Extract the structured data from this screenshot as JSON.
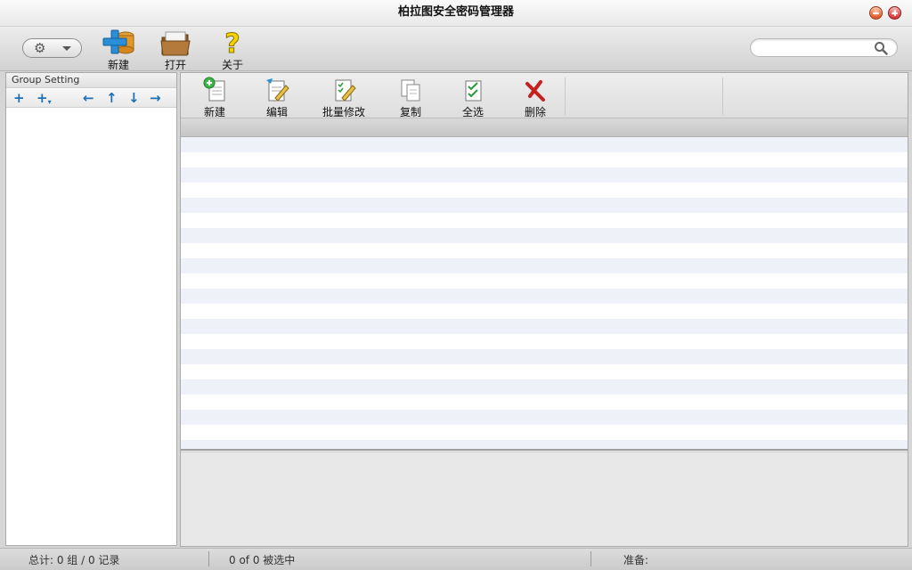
{
  "window": {
    "title": "柏拉图安全密码管理器"
  },
  "main_toolbar": {
    "new_label": "新建",
    "open_label": "打开",
    "about_label": "关于",
    "search_placeholder": ""
  },
  "group_panel": {
    "title": "Group Setting"
  },
  "entry_toolbar": {
    "new_label": "新建",
    "edit_label": "编辑",
    "batch_edit_label": "批量修改",
    "copy_label": "复制",
    "select_all_label": "全选",
    "delete_label": "删除"
  },
  "status_bar": {
    "totals": "总计: 0 组 / 0 记录",
    "selection": "0 of 0 被选中",
    "ready": "准备:"
  }
}
